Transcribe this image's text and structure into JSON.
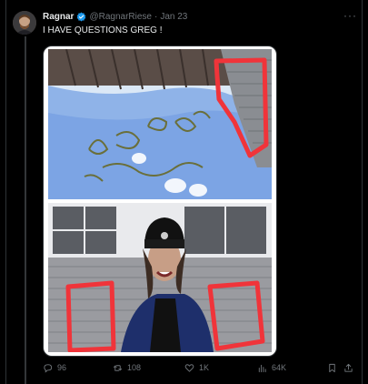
{
  "tweet": {
    "author_name": "Ragnar",
    "author_handle": "@RagnarRiese",
    "separator": "·",
    "timestamp": "Jan 23",
    "text": "I HAVE QUESTIONS GREG !",
    "more_label": "···"
  },
  "actions": {
    "replies": "96",
    "retweets": "108",
    "likes": "1K",
    "views": "64K"
  },
  "colors": {
    "background": "#000000",
    "verified_badge": "#1d9bf0",
    "annotation_red": "#f0343a",
    "muted_text": "#71767b"
  },
  "icons": [
    "verified-badge-icon",
    "more-icon",
    "reply-icon",
    "retweet-icon",
    "like-icon",
    "views-icon",
    "bookmark-icon",
    "share-icon"
  ]
}
